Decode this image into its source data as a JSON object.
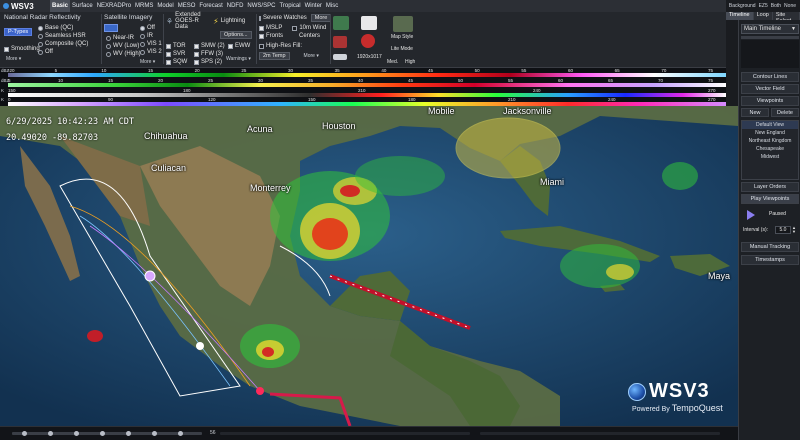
{
  "app": {
    "title": "WSV3"
  },
  "menu": [
    "Basic",
    "Surface",
    "NEXRADPro",
    "MRMS",
    "Model",
    "MESO",
    "Forecast",
    "NDFD",
    "NWS/SPC",
    "Tropical",
    "Winter",
    "Misc"
  ],
  "menu_active": "Basic",
  "topright": [
    "Background",
    "EZ5",
    "Both",
    "None"
  ],
  "right_tabs": [
    "Timeline",
    "Loop",
    "Site Select"
  ],
  "ribbon": {
    "radar": {
      "title": "National Radar Reflectivity",
      "ptypes_btn": "P-Types",
      "options": [
        "Base (QC)",
        "Seamless HSR",
        "Composite (QC)",
        "Off"
      ],
      "smoothing": "Smoothing",
      "more": "More"
    },
    "satellite": {
      "title": "Satellite Imagery",
      "items": [
        "Near-IR",
        "WV (Low)",
        "WV (High)"
      ],
      "right_items": [
        "Off",
        "IR",
        "VIS 1",
        "VIS 2"
      ],
      "more": "More"
    },
    "goes": {
      "title": "Extended GOES-R Data"
    },
    "lightning": {
      "title": "Lightning",
      "options_btn": "Options..."
    },
    "warnings": {
      "col1": [
        "TOR",
        "SVR",
        "SQW"
      ],
      "col2": [
        "SMW (2)",
        "FFW (3)",
        "SPS (2)"
      ],
      "col3": [
        "EWW"
      ],
      "btn": "Warnings"
    },
    "watches": {
      "severe": "Severe Watches",
      "more": "More",
      "mslp": "MSLP",
      "wind": "10m Wind",
      "fronts": "Fronts",
      "centers": "Centers",
      "hires": "High-Res Fill:",
      "temp": "2m Temp",
      "more2": "More"
    },
    "tools": {
      "resolution": "1920x1017",
      "map_style": "Map Style",
      "lite_mode": "Lite Mode",
      "med": "Med.",
      "high": "High"
    }
  },
  "scales": {
    "row1": {
      "unit": "dBZ",
      "labels": [
        "-20",
        "5",
        "10",
        "15",
        "20",
        "25",
        "30",
        "35",
        "40",
        "45",
        "50",
        "55",
        "60",
        "65",
        "70",
        "75"
      ]
    },
    "row2": {
      "unit": "dBZ",
      "labels": [
        "5",
        "10",
        "15",
        "20",
        "25",
        "30",
        "35",
        "40",
        "45",
        "50",
        "55",
        "60",
        "65",
        "70",
        "75"
      ]
    },
    "row3": {
      "unit": "K",
      "labels": [
        "150",
        "180",
        "210",
        "240",
        "270"
      ]
    },
    "row4": {
      "unit": "K",
      "labels": [
        "0",
        "90",
        "120",
        "150",
        "180",
        "210",
        "240",
        "270"
      ]
    }
  },
  "readout": {
    "datetime": "6/29/2025  10:42:23 AM CDT",
    "coords": "20.49020  -89.82703"
  },
  "cities": {
    "chihuahua": "Chihuahua",
    "acuna": "Acuna",
    "houston": "Houston",
    "mobile": "Mobile",
    "jacksonville": "Jacksonville",
    "monterrey": "Monterrey",
    "culiacan": "Culiacan",
    "miami": "Miami",
    "mayaguana": "Maya"
  },
  "watermark": {
    "brand": "WSV3",
    "powered": "Powered By",
    "company": "TempoQuest"
  },
  "right_panel": {
    "timeline": "Main Timeline",
    "contour": "Contour Lines",
    "vector": "Vector Field",
    "viewpoints": "Viewpoints",
    "new": "New",
    "delete": "Delete",
    "views": [
      "Default View",
      "New England",
      "Northeast Kingdom",
      "Chesapeake",
      "Midwest"
    ],
    "layer_orders": "Layer Orders",
    "play_viewpoints": "Play Viewpoints",
    "paused": "Paused",
    "interval_label": "Interval (s):",
    "interval_value": "5.0",
    "manual_tracking": "Manual Tracking",
    "timestamps": "Timestamps"
  },
  "bottom": {
    "frame_label": "56"
  },
  "colors": {
    "accent": "#3b63c9",
    "play": "#8a7ef0"
  }
}
